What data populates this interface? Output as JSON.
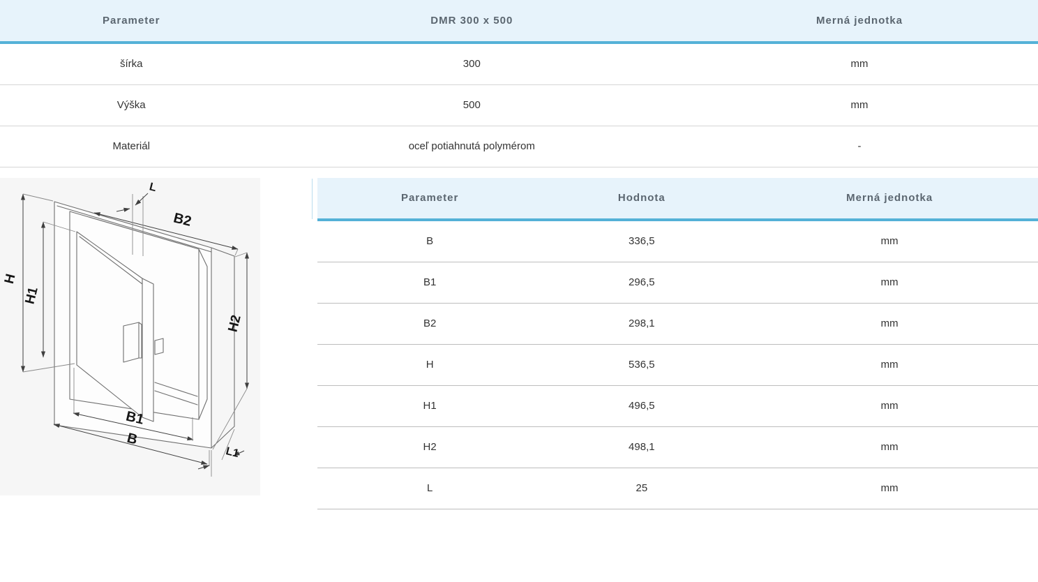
{
  "theme": {
    "accent_border": "#54b1d7",
    "header_bg": "#e7f3fb",
    "header_text": "#5b6670",
    "body_text": "#333333",
    "row_border_light": "#d6d6d6",
    "row_border_mid": "#bdbdbd",
    "diagram_bg": "#f6f6f6",
    "line_color": "#6f6f6f",
    "dim_color": "#3f3f3f"
  },
  "spec_table": {
    "headers": [
      "Parameter",
      "DMR 300 x 500",
      "Merná jednotka"
    ],
    "rows": [
      [
        "šírka",
        "300",
        "mm"
      ],
      [
        "Výška",
        "500",
        "mm"
      ],
      [
        "Materiál",
        "oceľ potiahnutá polymérom",
        "-"
      ]
    ]
  },
  "dims_table": {
    "headers": [
      "Parameter",
      "Hodnota",
      "Merná jednotka"
    ],
    "rows": [
      [
        "B",
        "336,5",
        "mm"
      ],
      [
        "B1",
        "296,5",
        "mm"
      ],
      [
        "B2",
        "298,1",
        "mm"
      ],
      [
        "H",
        "536,5",
        "mm"
      ],
      [
        "H1",
        "496,5",
        "mm"
      ],
      [
        "H2",
        "498,1",
        "mm"
      ],
      [
        "L",
        "25",
        "mm"
      ]
    ]
  },
  "diagram": {
    "labels": {
      "h": "H",
      "h1": "H1",
      "h2": "H2",
      "b": "B",
      "b1": "B1",
      "b2": "B2",
      "l": "L",
      "l1": "L1"
    }
  }
}
